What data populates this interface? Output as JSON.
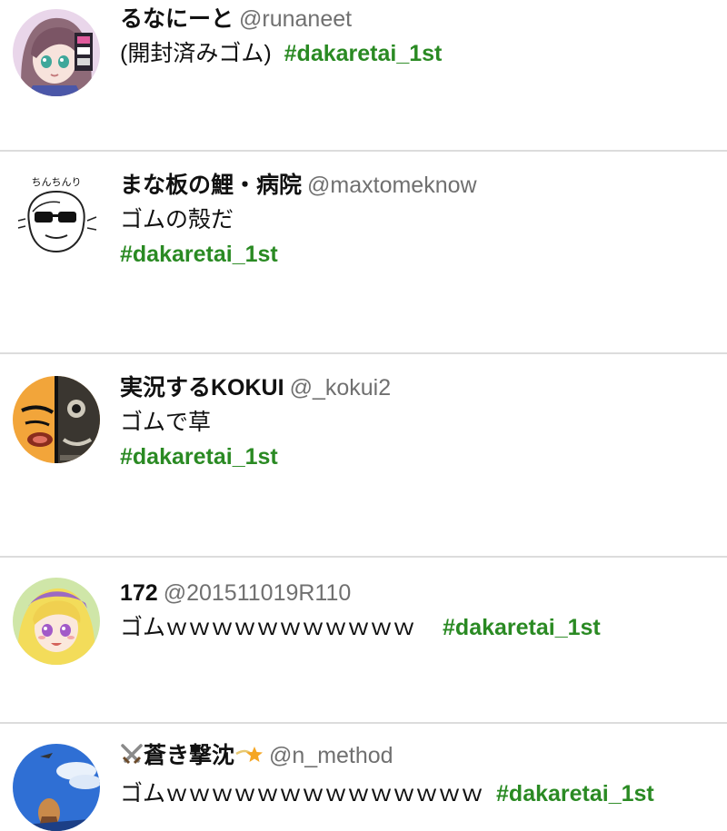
{
  "tweets": [
    {
      "name": "るなにーと",
      "handle": "@runaneet",
      "text": "(開封済みゴム)",
      "hashtag": "#dakaretai_1st"
    },
    {
      "name": "まな板の鯉・病院",
      "handle": "@maxtomeknow",
      "text": "ゴムの殻だ",
      "hashtag": "#dakaretai_1st",
      "avatar_caption": "ちんちんり"
    },
    {
      "name": "実況するKOKUI",
      "handle": "@_kokui2",
      "text": "ゴムで草",
      "hashtag": "#dakaretai_1st"
    },
    {
      "name": "172",
      "handle": "@201511019R110",
      "text": "ゴムｗｗｗｗｗｗｗｗｗｗｗ",
      "hashtag": "#dakaretai_1st"
    },
    {
      "name": "蒼き撃沈",
      "handle": "@n_method",
      "text": "ゴムｗｗｗｗｗｗｗｗｗｗｗｗｗｗ",
      "hashtag": "#dakaretai_1st",
      "name_prefix_icon": "crossed-swords-icon",
      "name_suffix_icon": "shooting-star-icon"
    }
  ],
  "colors": {
    "hashtag": "#2a8a23",
    "handle": "#707070",
    "divider": "#dcdcdc",
    "name": "#111111"
  }
}
